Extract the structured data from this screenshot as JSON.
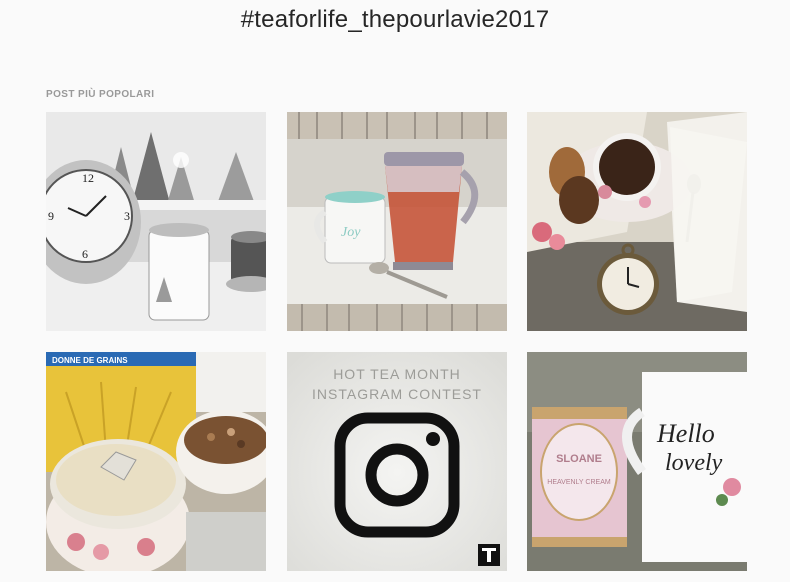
{
  "header": {
    "hashtag": "#teaforlife_thepourlavie2017"
  },
  "section": {
    "label": "POST PIÙ POPOLARI"
  },
  "posts": [
    {
      "icon": "clock-window-tea-photo"
    },
    {
      "icon": "joy-mug-teapot-photo",
      "mug_text": "Joy"
    },
    {
      "icon": "tea-cookies-pocket-watch-photo"
    },
    {
      "icon": "chai-tea-granola-photo",
      "box_text": "DONNE DE GRAINS"
    },
    {
      "icon": "instagram-contest-graphic",
      "line1": "HOT TEA MONTH",
      "line2": "INSTAGRAM CONTEST"
    },
    {
      "icon": "sloane-tin-hello-lovely-mug-photo",
      "tin_brand": "SLOANE",
      "tin_flavor": "HEAVENLY CREAM",
      "mug_line1": "Hello",
      "mug_line2": "lovely"
    }
  ]
}
